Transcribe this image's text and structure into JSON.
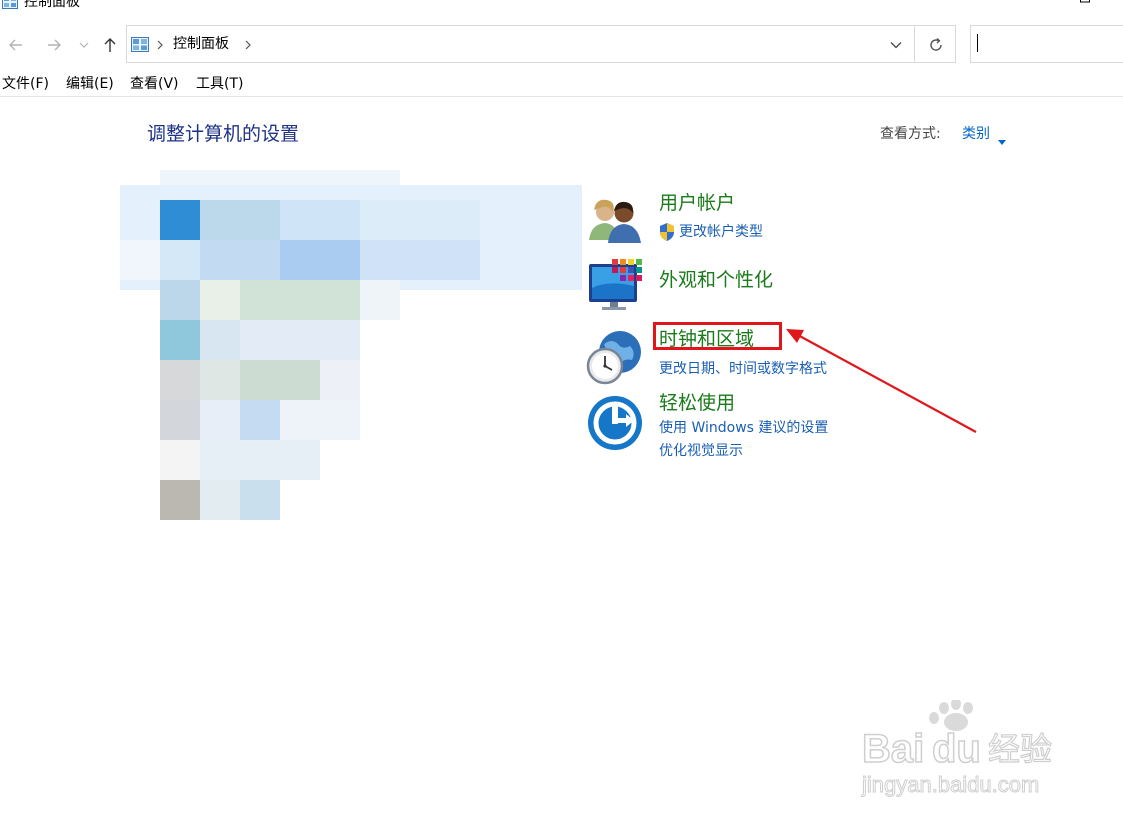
{
  "window": {
    "title": "控制面板",
    "minimize_icon": "minimize-icon",
    "maximize_icon": "maximize-icon"
  },
  "nav": {
    "back_icon": "back-arrow-icon",
    "forward_icon": "forward-arrow-icon",
    "recent_icon": "chevron-down-icon",
    "up_icon": "up-arrow-icon"
  },
  "address": {
    "breadcrumb": "控制面板",
    "search_value": ""
  },
  "menu": {
    "file": "文件(F)",
    "edit": "编辑(E)",
    "view": "查看(V)",
    "tools": "工具(T)"
  },
  "content": {
    "title": "调整计算机的设置",
    "view_by_label": "查看方式:",
    "view_by_value": "类别"
  },
  "categories": [
    {
      "title": "用户帐户",
      "links": [
        "更改帐户类型"
      ],
      "icon": "users-icon",
      "link_icons": [
        "shield-icon"
      ]
    },
    {
      "title": "外观和个性化",
      "links": [],
      "icon": "monitor-personalization-icon"
    },
    {
      "title": "时钟和区域",
      "links": [
        "更改日期、时间或数字格式"
      ],
      "icon": "clock-globe-icon"
    },
    {
      "title": "轻松使用",
      "links": [
        "使用 Windows 建议的设置",
        "优化视觉显示"
      ],
      "icon": "ease-of-access-icon"
    }
  ],
  "annotation": {
    "highlight_color": "#e0161b",
    "highlight_target": "时钟和区域"
  },
  "watermark": {
    "brand": "Baidu经验",
    "url": "jingyan.baidu.com"
  },
  "colors": {
    "title_blue": "#1e3287",
    "category_green": "#1a7b1a",
    "link_blue": "#1a5fb4"
  }
}
